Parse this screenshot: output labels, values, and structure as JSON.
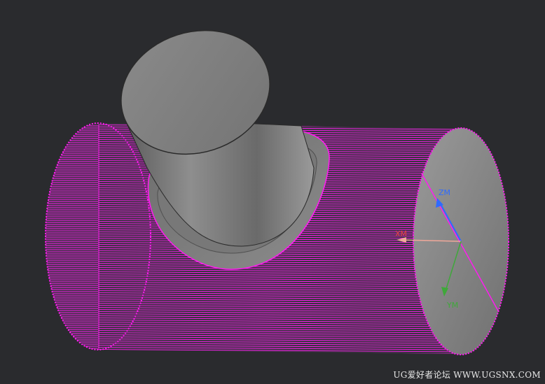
{
  "viewport": {
    "background": "#2a2b2e",
    "highlight_color": "#ff1cf0",
    "body_color": "#8a8a8a"
  },
  "axes": {
    "zm": {
      "label": "ZM",
      "color": "#2e6bff"
    },
    "xm": {
      "label": "XM",
      "color": "#e5473d"
    },
    "ym": {
      "label": "YM",
      "color": "#3fa83a"
    }
  },
  "watermark": {
    "text": "UG爱好者论坛  WWW.UGSNX.COM"
  }
}
